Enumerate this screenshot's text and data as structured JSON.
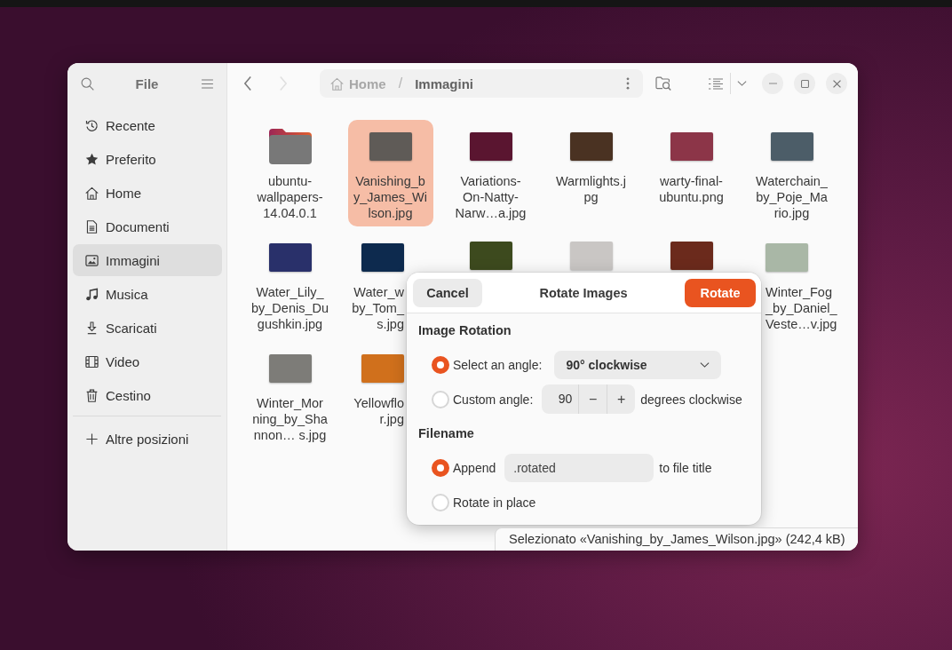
{
  "sidebar": {
    "title": "File",
    "items": [
      {
        "kind": "recent",
        "label": "Recente",
        "selected": false
      },
      {
        "kind": "starred",
        "label": "Preferito",
        "selected": false
      },
      {
        "kind": "home",
        "label": "Home",
        "selected": false
      },
      {
        "kind": "documents",
        "label": "Documenti",
        "selected": false
      },
      {
        "kind": "pictures",
        "label": "Immagini",
        "selected": true
      },
      {
        "kind": "music",
        "label": "Musica",
        "selected": false
      },
      {
        "kind": "downloads",
        "label": "Scaricati",
        "selected": false
      },
      {
        "kind": "videos",
        "label": "Video",
        "selected": false
      },
      {
        "kind": "trash",
        "label": "Cestino",
        "selected": false
      }
    ],
    "other_locations": "Altre posizioni"
  },
  "toolbar": {
    "nav": [
      {
        "kind": "back",
        "disabled": false
      },
      {
        "kind": "forward",
        "disabled": true
      }
    ],
    "path": [
      {
        "kind": "home",
        "label": "Home",
        "selected": false
      },
      {
        "kind": "folder",
        "label": "Immagini",
        "selected": true
      }
    ],
    "path_separator": "/"
  },
  "files": [
    {
      "kind": "folder",
      "selected": false,
      "label_lines": [
        "ubuntu-",
        "wallpapers-",
        "14.04.0.1"
      ]
    },
    {
      "kind": "image",
      "color": "#5f5b57",
      "selected": true,
      "label_lines": [
        "Vanishing_b",
        "y_James_Wi",
        "lson.jpg"
      ]
    },
    {
      "kind": "image",
      "color": "#5a1530",
      "selected": false,
      "label_lines": [
        "Variations-",
        "On-Natty-",
        "Narw…a.jpg"
      ]
    },
    {
      "kind": "image",
      "color": "#4a3222",
      "selected": false,
      "label_lines": [
        "Warmlights.j",
        "pg"
      ]
    },
    {
      "kind": "image",
      "color": "#8c3548",
      "selected": false,
      "label_lines": [
        "warty-final-",
        "ubuntu.png"
      ]
    },
    {
      "kind": "image",
      "color": "#4c5d68",
      "selected": false,
      "label_lines": [
        "Waterchain_",
        "by_Poje_Ma",
        "rio.jpg"
      ]
    },
    {
      "kind": "image",
      "color": "#29306a",
      "selected": false,
      "label_lines": [
        "Water_Lily_",
        "by_Denis_Du",
        "gushkin.jpg"
      ]
    },
    {
      "kind": "image",
      "color": "#0d2a4e",
      "selected": false,
      "label_lines": [
        "Water_w",
        "by_Tom_",
        "s.jpg"
      ]
    },
    {
      "kind": "image",
      "color": "#3d4a1e",
      "selected": false
    },
    {
      "kind": "image",
      "color": "#c9c6c4",
      "selected": false
    },
    {
      "kind": "image",
      "color": "#6b2a1c",
      "selected": false
    },
    {
      "kind": "image",
      "color": "#a9b7a6",
      "selected": false,
      "label_lines": [
        "Winter_Fog",
        "_by_Daniel_",
        "Veste…v.jpg"
      ]
    },
    {
      "kind": "image",
      "color": "#7d7c78",
      "selected": false,
      "label_lines": [
        "Winter_Mor",
        "ning_by_Sha",
        "nnon… s.jpg"
      ]
    },
    {
      "kind": "image",
      "color": "#d0701c",
      "selected": false,
      "label_lines": [
        "Yellowflo",
        "r.jpg"
      ]
    }
  ],
  "dialog": {
    "cancel": "Cancel",
    "title": "Rotate Images",
    "confirm": "Rotate",
    "sections": [
      {
        "heading": "Image Rotation",
        "options": [
          {
            "kind": "dropdown",
            "label": "Select an angle:",
            "selected": true,
            "value": "90° clockwise"
          },
          {
            "kind": "spin",
            "label": "Custom angle:",
            "selected": false,
            "value": "90",
            "minus": "−",
            "plus": "+",
            "suffix": "degrees clockwise"
          }
        ]
      },
      {
        "heading": "Filename",
        "options": [
          {
            "kind": "entry",
            "label": "Append",
            "selected": true,
            "value": ".rotated",
            "suffix": "to file title"
          },
          {
            "kind": "plain",
            "label": "Rotate in place",
            "selected": false
          }
        ]
      }
    ]
  },
  "status_bar": "Selezionato «Vanishing_by_James_Wilson.jpg» (242,4 kB)"
}
